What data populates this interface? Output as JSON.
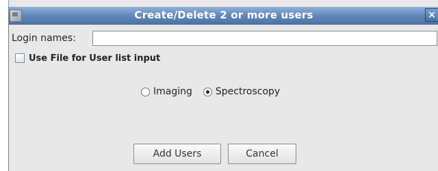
{
  "dialog": {
    "title": "Create/Delete 2 or more users",
    "close_glyph": "×",
    "icons": {
      "app": "window-icon",
      "close": "close-icon"
    }
  },
  "login": {
    "label": "Login names:",
    "value": ""
  },
  "file_option": {
    "label": "Use File for User list input",
    "checked": false
  },
  "mode": {
    "options": [
      {
        "label": "Imaging",
        "selected": false
      },
      {
        "label": "Spectroscopy",
        "selected": true
      }
    ]
  },
  "buttons": {
    "add_label": "Add Users",
    "cancel_label": "Cancel"
  },
  "colors": {
    "titlebar": "#5f85b7",
    "dialog_bg": "#e8e8e8"
  }
}
